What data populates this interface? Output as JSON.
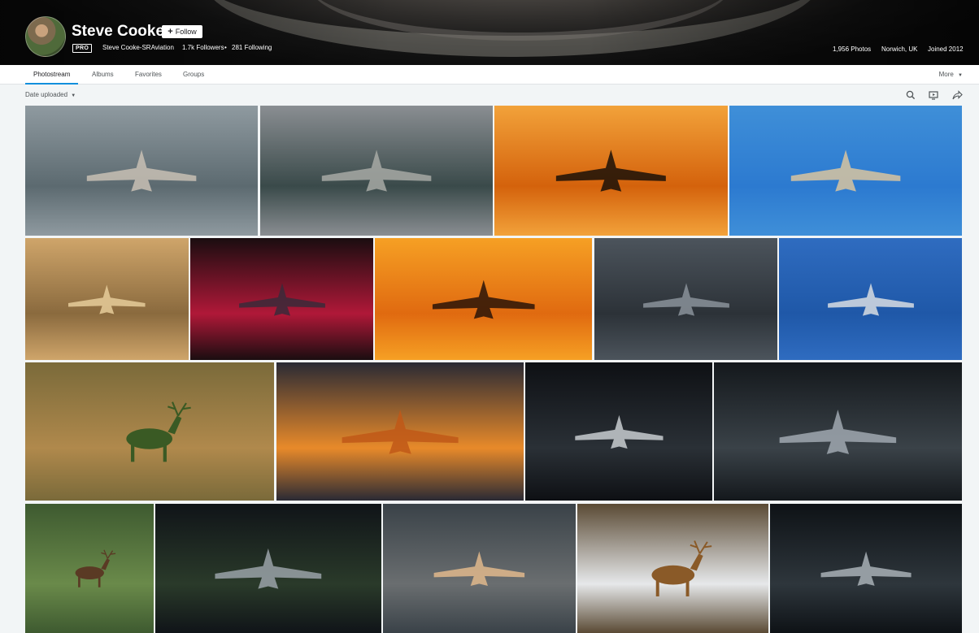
{
  "profile": {
    "name": "Steve Cooke",
    "follow_label": "Follow",
    "pro_badge": "PRO",
    "username": "Steve Cooke-SRAviation",
    "followers": "1.7k Followers",
    "separator": "•",
    "following": "281 Following",
    "photos_count": "1,956 Photos",
    "location": "Norwich, UK",
    "joined": "Joined 2012"
  },
  "tabs": [
    {
      "label": "Photostream",
      "active": true
    },
    {
      "label": "Albums",
      "active": false
    },
    {
      "label": "Favorites",
      "active": false
    },
    {
      "label": "Groups",
      "active": false
    }
  ],
  "more_label": "More",
  "sort_label": "Date uploaded",
  "icons": {
    "search": "search-icon",
    "slideshow": "slideshow-icon",
    "share": "share-icon",
    "caret": "caret-down-icon"
  },
  "photos": [
    {
      "subject": "fighter-jet",
      "palette": [
        "#8f9aa0",
        "#5c6a70",
        "#c8c0b4"
      ]
    },
    {
      "subject": "fighter-jet",
      "palette": [
        "#8a8e92",
        "#3a4a4a",
        "#a7a9a5"
      ]
    },
    {
      "subject": "fighter-jet",
      "palette": [
        "#f2a23a",
        "#d4620c",
        "#1a1008"
      ]
    },
    {
      "subject": "fighter-jet",
      "palette": [
        "#3f8fd8",
        "#2c7ad0",
        "#d8c4a0"
      ]
    },
    {
      "subject": "fighter-jet",
      "palette": [
        "#cfa56a",
        "#8a6a3e",
        "#e6cd9a"
      ]
    },
    {
      "subject": "fighter-jet",
      "palette": [
        "#1a0d10",
        "#b01838",
        "#3a2a3a"
      ]
    },
    {
      "subject": "fighter-jet",
      "palette": [
        "#f6a024",
        "#e06a10",
        "#2a1408"
      ]
    },
    {
      "subject": "fighter-jet",
      "palette": [
        "#4c545c",
        "#2c3238",
        "#8a929a"
      ]
    },
    {
      "subject": "fighter-jet",
      "palette": [
        "#2f6cc0",
        "#1f58a8",
        "#d8dde2"
      ]
    },
    {
      "subject": "deer",
      "palette": [
        "#7a6a3a",
        "#b0894c",
        "#3a5a24"
      ]
    },
    {
      "subject": "fighter-jet",
      "palette": [
        "#2a2a34",
        "#e88a2a",
        "#c05818"
      ]
    },
    {
      "subject": "fighter-jet",
      "palette": [
        "#0e1014",
        "#2a3036",
        "#c8ccd0"
      ]
    },
    {
      "subject": "fighter-jet",
      "palette": [
        "#14181c",
        "#3a4248",
        "#a0a8b0"
      ]
    },
    {
      "subject": "deer",
      "palette": [
        "#3e5a30",
        "#6a8a4a",
        "#5a3a24"
      ]
    },
    {
      "subject": "fighter-jet",
      "palette": [
        "#101418",
        "#2a3a2a",
        "#9aa2a8"
      ]
    },
    {
      "subject": "fighter-jet",
      "palette": [
        "#3a4248",
        "#6a6e70",
        "#e0b88c"
      ]
    },
    {
      "subject": "deer",
      "palette": [
        "#5a4a34",
        "#e6e8ea",
        "#8a5a28"
      ]
    },
    {
      "subject": "fighter-jet",
      "palette": [
        "#0e1216",
        "#2e363c",
        "#a8b0b6"
      ]
    }
  ]
}
